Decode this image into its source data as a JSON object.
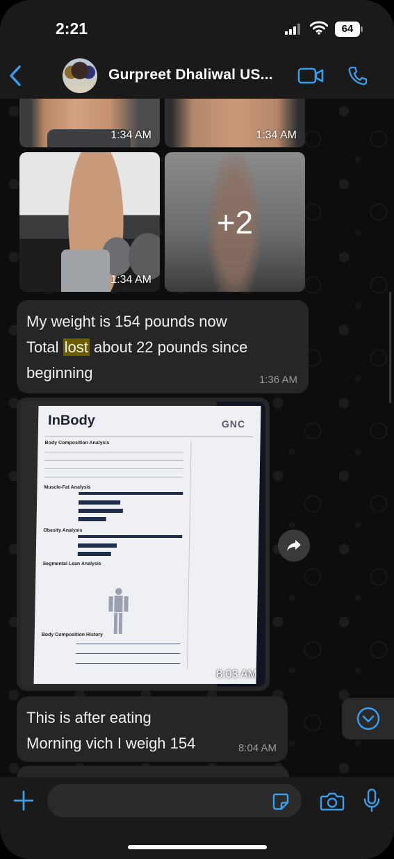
{
  "status_bar": {
    "time": "2:21",
    "battery": "64"
  },
  "header": {
    "contact_name": "Gurpreet Dhaliwal US..."
  },
  "photos": {
    "top_left_time": "1:34 AM",
    "top_right_time": "1:34 AM",
    "side_time": "1:34 AM",
    "more_count": "+2"
  },
  "messages": {
    "weight": {
      "line1": "My weight is 154 pounds now",
      "line2_pre": "Total ",
      "line2_highlight": "lost",
      "line2_post": " about 22 pounds since",
      "line3": "beginning",
      "time": "1:36 AM"
    },
    "report": {
      "logo": "InBody",
      "brand": "GNC",
      "sections": [
        "Body Composition Analysis",
        "Muscle-Fat Analysis",
        "Obesity Analysis",
        "Segmental Lean Analysis",
        "Body Composition History"
      ],
      "time": "8:03 AM"
    },
    "after_eating": {
      "line1": "This is after eating",
      "line2": "Morning vich I weigh 154",
      "time": "8:04 AM"
    }
  },
  "colors": {
    "accent": "#3a9eea",
    "bubble": "#262626",
    "highlight": "#6b5d00"
  }
}
